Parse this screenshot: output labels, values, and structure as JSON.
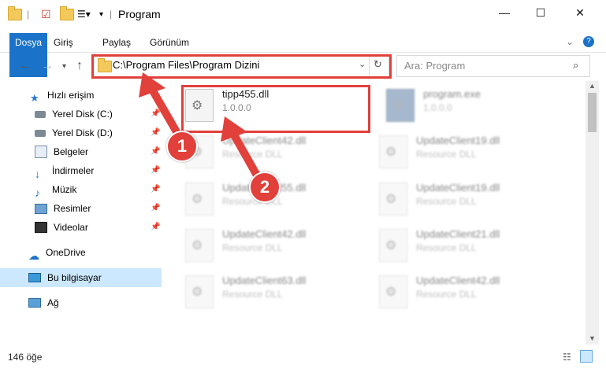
{
  "window": {
    "title": "Program",
    "controls": {
      "minimize": "—",
      "maximize": "☐",
      "close": "✕"
    }
  },
  "ribbon": {
    "tabs": [
      "Dosya",
      "Giriş",
      "Paylaş",
      "Görünüm"
    ]
  },
  "address": {
    "path": "C:\\Program Files\\Program Dizini",
    "search_placeholder": "Ara: Program"
  },
  "sidebar": {
    "quick_access": "Hızlı erişim",
    "items": [
      {
        "label": "Yerel Disk (C:)",
        "icon": "drive-icon"
      },
      {
        "label": "Yerel Disk (D:)",
        "icon": "drive-icon"
      },
      {
        "label": "Belgeler",
        "icon": "documents-icon"
      },
      {
        "label": "İndirmeler",
        "icon": "download-icon"
      },
      {
        "label": "Müzik",
        "icon": "music-icon"
      },
      {
        "label": "Resimler",
        "icon": "pictures-icon"
      },
      {
        "label": "Videolar",
        "icon": "video-icon"
      }
    ],
    "onedrive": "OneDrive",
    "this_pc": "Bu bilgisayar",
    "network": "Ağ"
  },
  "files": [
    {
      "name": "tipp455.dll",
      "sub": "1.0.0.0",
      "highlight": true
    },
    {
      "name": "program.exe",
      "sub": "1.0.0.0"
    },
    {
      "name": "UpdateClient42.dll",
      "sub": "Resource DLL"
    },
    {
      "name": "UpdateClient19.dll",
      "sub": "Resource DLL"
    },
    {
      "name": "UpdateClient55.dll",
      "sub": "Resource DLL"
    },
    {
      "name": "UpdateClient19.dll",
      "sub": "Resource DLL"
    },
    {
      "name": "UpdateClient42.dll",
      "sub": "Resource DLL"
    },
    {
      "name": "UpdateClient21.dll",
      "sub": "Resource DLL"
    },
    {
      "name": "UpdateClient63.dll",
      "sub": "Resource DLL"
    },
    {
      "name": "UpdateClient42.dll",
      "sub": "Resource DLL"
    }
  ],
  "status": {
    "count": "146 öğe"
  },
  "annotations": {
    "one": "1",
    "two": "2"
  },
  "colors": {
    "accent": "#1a73c8",
    "highlight": "#e2403b",
    "selection": "#cce8ff"
  }
}
